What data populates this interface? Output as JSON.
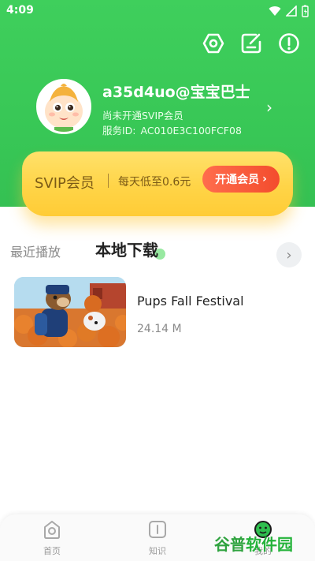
{
  "status_bar": {
    "time": "4:09",
    "icons": [
      "wifi-icon",
      "signal-icon",
      "battery-icon"
    ]
  },
  "top_actions": [
    "settings-icon",
    "edit-icon",
    "alert-icon"
  ],
  "profile": {
    "username": "a35d4uo@宝宝巴士",
    "vip_status": "尚未开通SVIP会员",
    "service_id_label": "服务ID:",
    "service_id_value": "AC010E3C100FCF08",
    "arrow": "›"
  },
  "vip_card": {
    "title": "SVIP会员",
    "price_text": "每天低至0.6元",
    "button_label": "开通会员",
    "button_arrow": "›"
  },
  "tabs": {
    "recent": "最近播放",
    "local": "本地下载",
    "arrow": "›"
  },
  "downloads": [
    {
      "title": "Pups Fall Festival",
      "size": "24.14 M"
    }
  ],
  "bottom_nav": {
    "home": "首页",
    "knowledge": "知识",
    "mine": "我的"
  },
  "watermark": {
    "part1": "谷普",
    "part2": "软件园"
  },
  "colors": {
    "brand_green": "#3fcf5c",
    "vip_gold": "#ffd447",
    "vip_button": "#f34c2d"
  }
}
